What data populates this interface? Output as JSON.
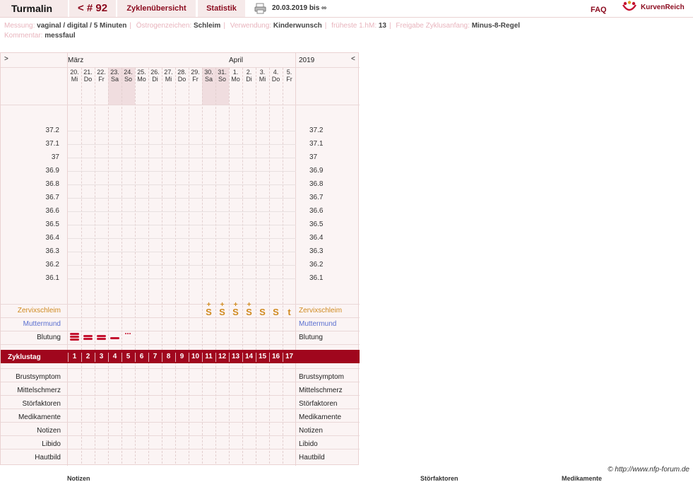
{
  "header": {
    "app_title": "Turmalin",
    "cycle_label": "< # 92",
    "overview_tab": "Zyklenübersicht",
    "stats_tab": "Statistik",
    "date_range": "20.03.2019 bis ∞",
    "faq": "FAQ",
    "logo_text": "KurvenReich"
  },
  "info": {
    "messung_label": "Messung:",
    "messung_value": "vaginal / digital / 5 Minuten",
    "oestrogen_label": "Östrogenzeichen:",
    "oestrogen_value": "Schleim",
    "verwendung_label": "Verwendung:",
    "verwendung_value": "Kinderwunsch",
    "hm_label": "früheste 1.hM:",
    "hm_value": "13",
    "freigabe_label": "Freigabe Zyklusanfang:",
    "freigabe_value": "Minus-8-Regel",
    "kommentar_label": "Kommentar:",
    "kommentar_value": "messfaul"
  },
  "chart": {
    "nav_left": ">",
    "nav_right": "<",
    "year": "2019",
    "month_1": "März",
    "month_2": "April",
    "days": [
      {
        "date": "20.",
        "weekday": "Mi",
        "weekend": false
      },
      {
        "date": "21.",
        "weekday": "Do",
        "weekend": false
      },
      {
        "date": "22.",
        "weekday": "Fr",
        "weekend": false
      },
      {
        "date": "23.",
        "weekday": "Sa",
        "weekend": true
      },
      {
        "date": "24.",
        "weekday": "So",
        "weekend": true
      },
      {
        "date": "25.",
        "weekday": "Mo",
        "weekend": false
      },
      {
        "date": "26.",
        "weekday": "Di",
        "weekend": false
      },
      {
        "date": "27.",
        "weekday": "Mi",
        "weekend": false
      },
      {
        "date": "28.",
        "weekday": "Do",
        "weekend": false
      },
      {
        "date": "29.",
        "weekday": "Fr",
        "weekend": false
      },
      {
        "date": "30.",
        "weekday": "Sa",
        "weekend": true
      },
      {
        "date": "31.",
        "weekday": "So",
        "weekend": true
      },
      {
        "date": "1.",
        "weekday": "Mo",
        "weekend": false
      },
      {
        "date": "2.",
        "weekday": "Di",
        "weekend": false
      },
      {
        "date": "3.",
        "weekday": "Mi",
        "weekend": false
      },
      {
        "date": "4.",
        "weekday": "Do",
        "weekend": false
      },
      {
        "date": "5.",
        "weekday": "Fr",
        "weekend": false
      }
    ],
    "temperatures": [
      "37.2",
      "37.1",
      "37",
      "36.9",
      "36.8",
      "36.7",
      "36.6",
      "36.5",
      "36.4",
      "36.3",
      "36.2",
      "36.1"
    ],
    "row_labels": {
      "zervix": "Zervixschleim",
      "muttermund": "Muttermund",
      "blutung": "Blutung",
      "zyklustag": "Zyklustag",
      "brust": "Brustsymptom",
      "mittelschmerz": "Mittelschmerz",
      "stoer": "Störfaktoren",
      "medikamente": "Medikamente",
      "notizen": "Notizen",
      "libido": "Libido",
      "hautbild": "Hautbild"
    },
    "cycle_days": [
      "1",
      "2",
      "3",
      "4",
      "5",
      "6",
      "7",
      "8",
      "9",
      "10",
      "11",
      "12",
      "13",
      "14",
      "15",
      "16",
      "17"
    ],
    "mucus": [
      {
        "day": 11,
        "symbol": "S",
        "plus": "+"
      },
      {
        "day": 12,
        "symbol": "S",
        "plus": "+"
      },
      {
        "day": 13,
        "symbol": "S",
        "plus": "+"
      },
      {
        "day": 14,
        "symbol": "S",
        "plus": "+"
      },
      {
        "day": 15,
        "symbol": "S",
        "plus": ""
      },
      {
        "day": 16,
        "symbol": "S",
        "plus": ""
      },
      {
        "day": 17,
        "symbol": "t",
        "plus": ""
      }
    ],
    "bleeding": [
      3,
      2,
      2,
      1,
      0.5
    ]
  },
  "footer": {
    "copyright": "© http://www.nfp-forum.de",
    "bottom_1": "Notizen",
    "bottom_2": "Störfaktoren",
    "bottom_3": "Medikamente"
  },
  "colors": {
    "accent": "#8b0a1e",
    "cycle_bar": "#a0061d",
    "mucus": "#d08a20",
    "muttermund": "#5a6fd0",
    "blood": "#c4122f"
  }
}
